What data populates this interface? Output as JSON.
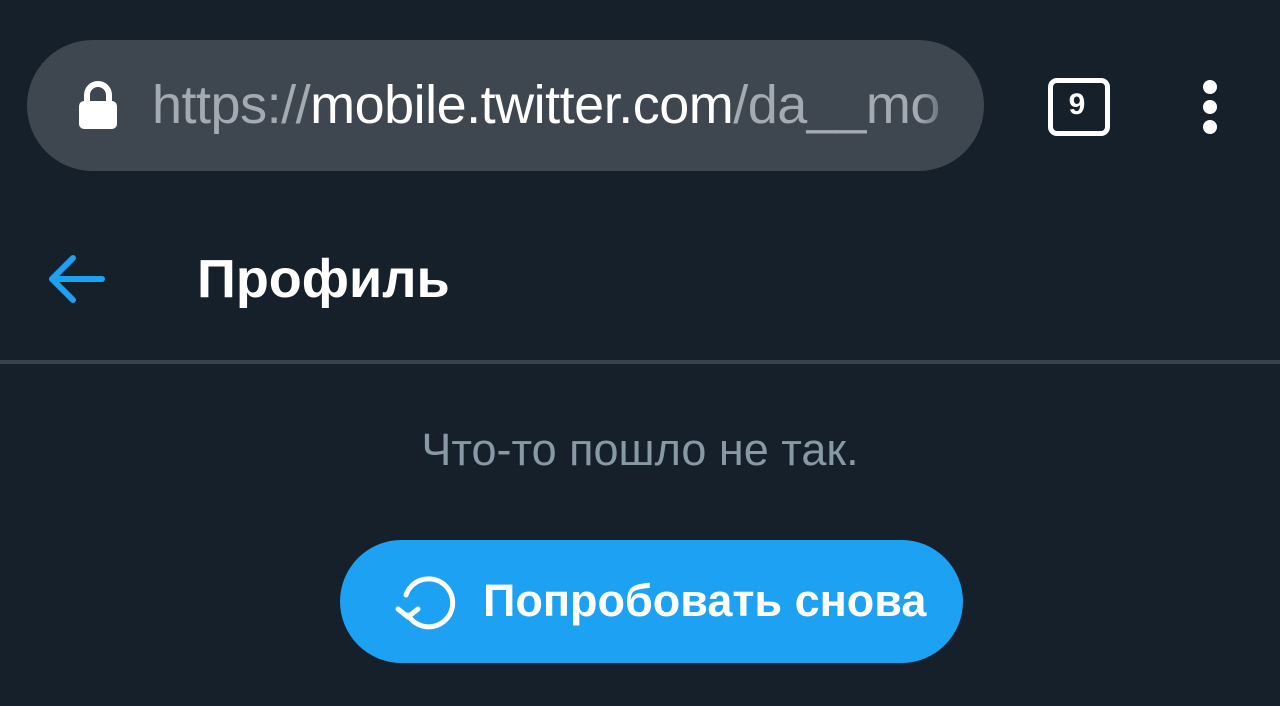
{
  "browser": {
    "url": {
      "scheme": "https://",
      "host": "mobile.twitter.com",
      "path": "/da__mo"
    },
    "tab_count": "9",
    "icons": {
      "lock": "lock-icon",
      "tabs": "tab-switcher-icon",
      "menu": "more-vert-icon"
    }
  },
  "header": {
    "back_icon": "arrow-left-icon",
    "title": "Профиль"
  },
  "main": {
    "error_text": "Что-то пошло не так.",
    "retry_label": "Попробовать снова",
    "retry_icon": "refresh-icon"
  },
  "colors": {
    "background": "#15202b",
    "omnibox": "#3e4750",
    "accent": "#1da1f2",
    "muted_text": "#8899a6",
    "divider": "#38444d"
  }
}
